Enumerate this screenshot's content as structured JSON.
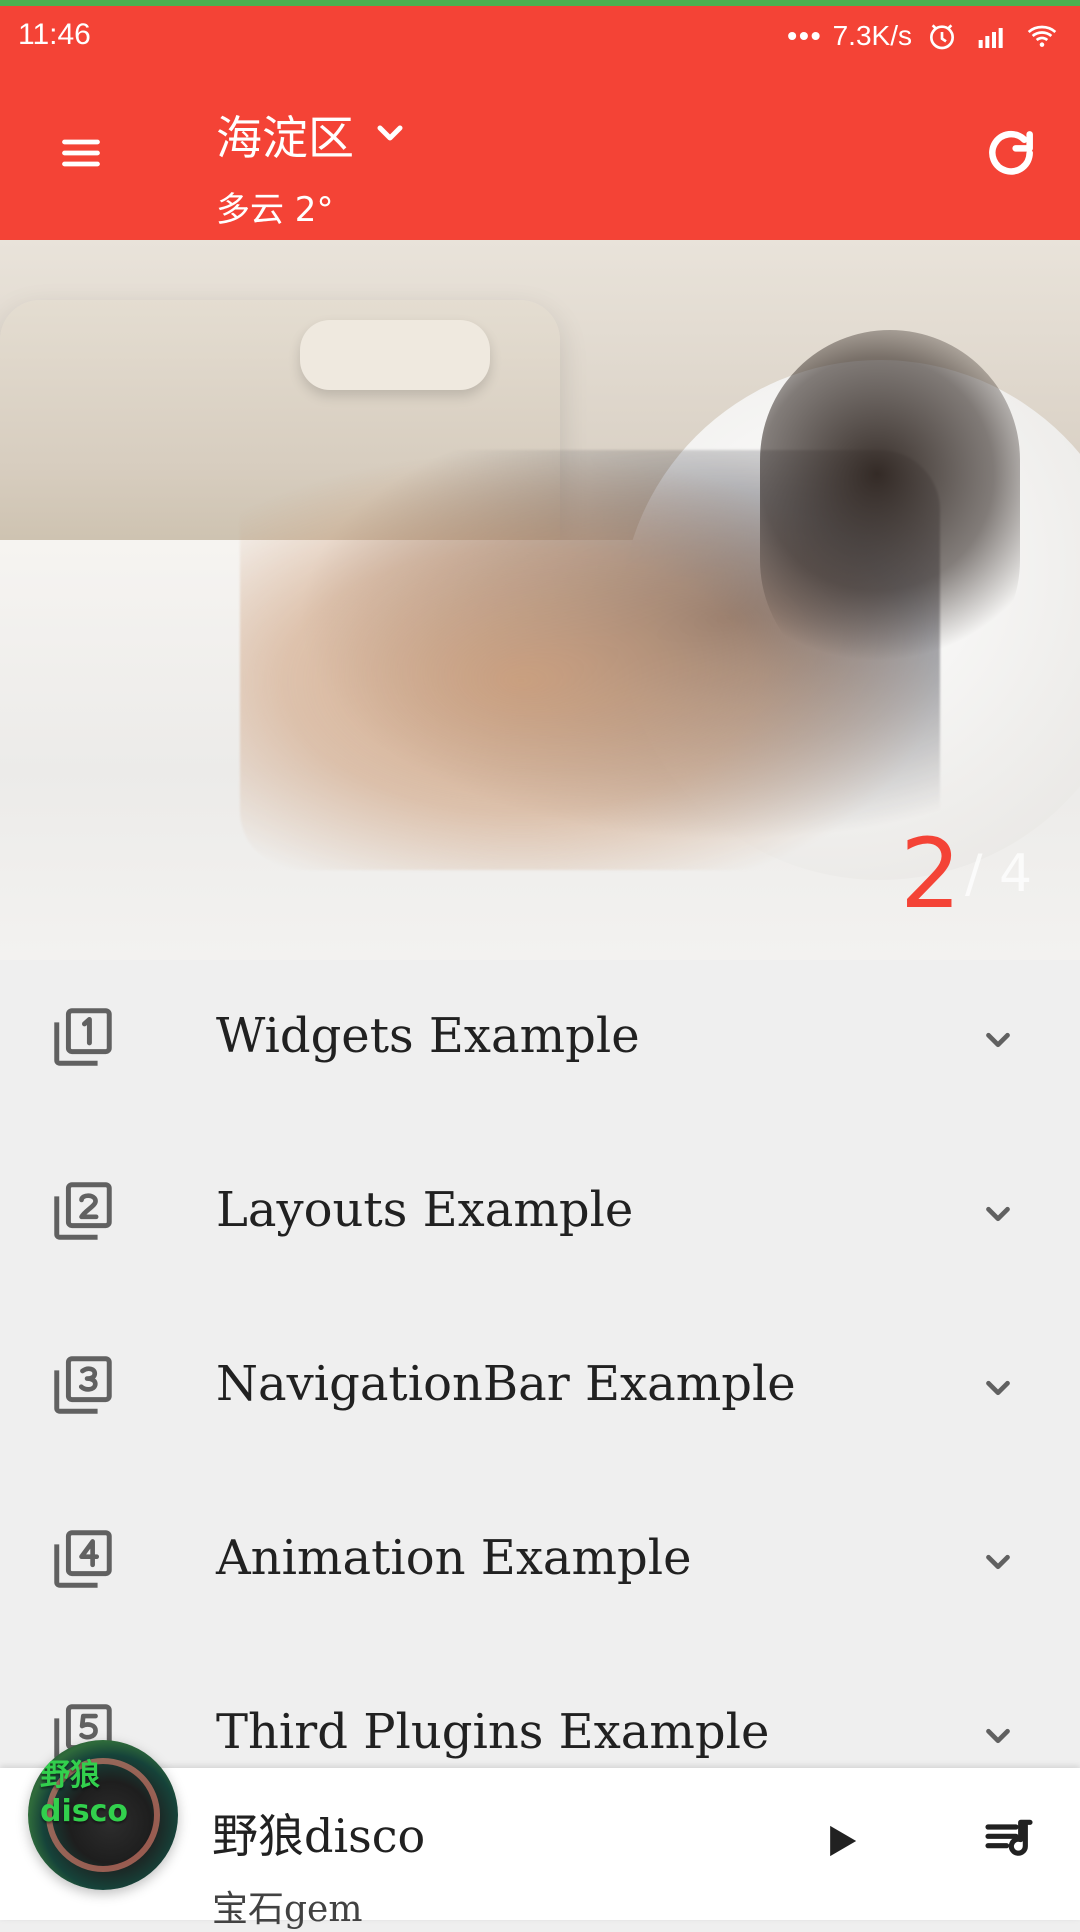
{
  "statusbar": {
    "time": "11:46",
    "speed": "7.3K/s",
    "icons": [
      "alarm-icon",
      "signal-icon",
      "wifi-icon"
    ]
  },
  "appbar": {
    "location": "海淀区",
    "weather": "多云 2°",
    "icons": {
      "menu": "menu-icon",
      "dropdown": "chevron-down-icon",
      "refresh": "refresh-icon"
    },
    "color": "#f44336"
  },
  "banner": {
    "current_page": "2",
    "page_rest": "/ 4",
    "accent": "#f44336"
  },
  "list": {
    "items": [
      {
        "label": "Widgets Example",
        "icon": "filter-1-icon"
      },
      {
        "label": "Layouts Example",
        "icon": "filter-2-icon"
      },
      {
        "label": "NavigationBar Example",
        "icon": "filter-3-icon"
      },
      {
        "label": "Animation Example",
        "icon": "filter-4-icon"
      },
      {
        "label": "Third Plugins Example",
        "icon": "filter-5-icon"
      }
    ],
    "chevron_icon": "chevron-down-icon"
  },
  "player": {
    "song_title": "野狼disco",
    "artist": "宝石gem",
    "album_text": "野狼disco",
    "icons": {
      "play": "play-icon",
      "queue": "playlist-icon"
    }
  }
}
